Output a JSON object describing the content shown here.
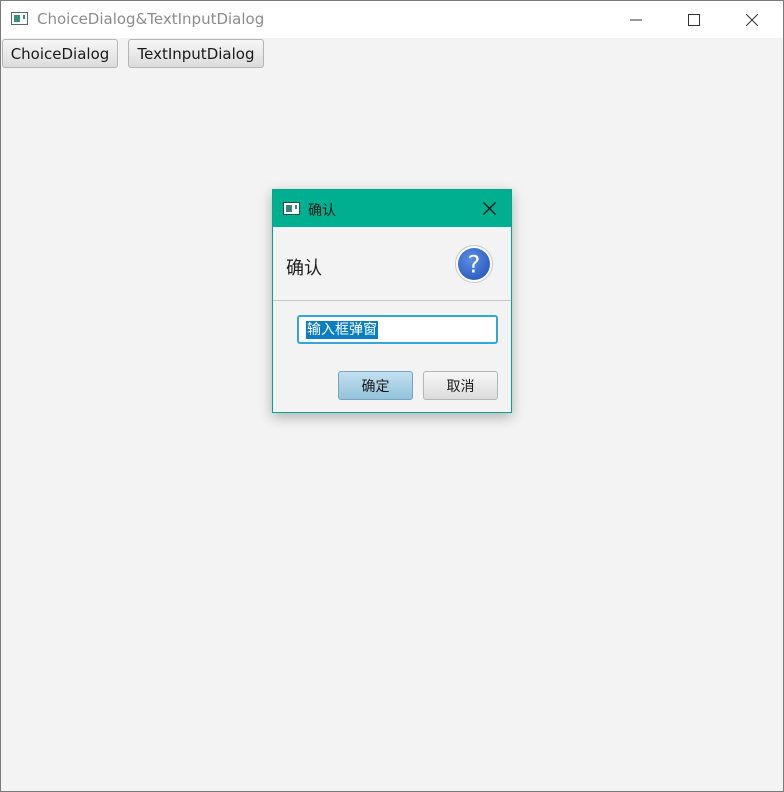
{
  "window": {
    "title": "ChoiceDialog&TextInputDialog",
    "icon": "app-window-icon",
    "controls": [
      "minimize-icon",
      "maximize-icon",
      "close-icon"
    ]
  },
  "toolbar": {
    "choice_dialog_label": "ChoiceDialog",
    "text_input_dialog_label": "TextInputDialog"
  },
  "dialog": {
    "title": "确认",
    "header_text": "确认",
    "header_icon": "question-icon",
    "input_value": "输入框弹窗",
    "ok_label": "确定",
    "cancel_label": "取消",
    "accent_color": "#00ae90",
    "focus_color": "#33a8d8"
  }
}
